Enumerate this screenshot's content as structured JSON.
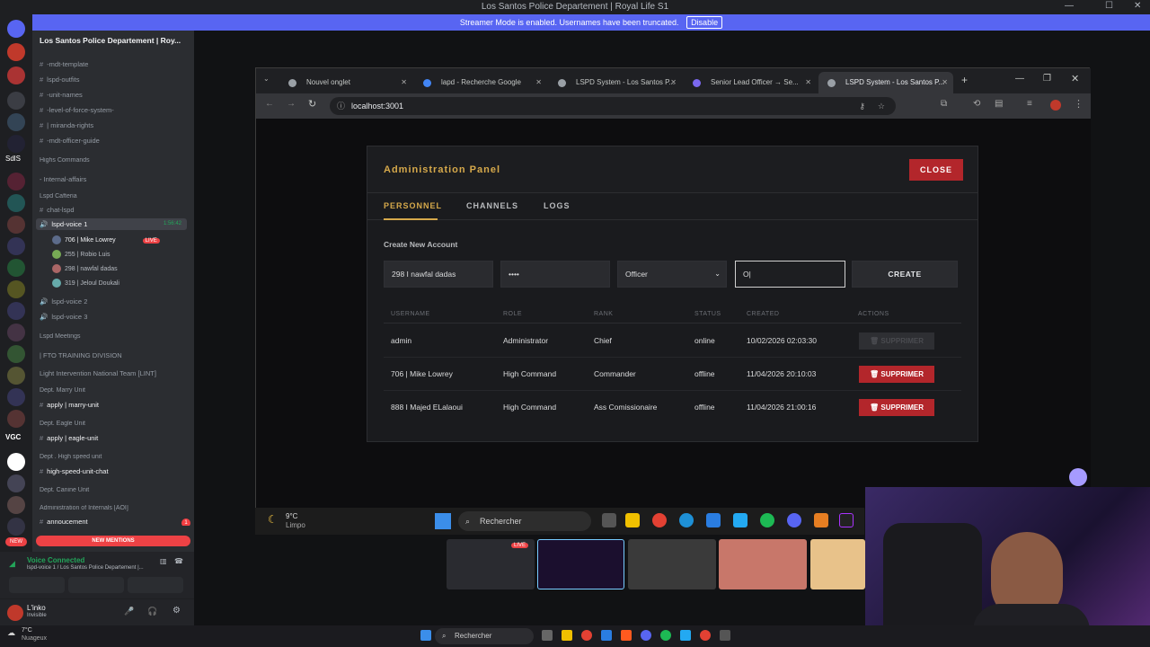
{
  "discord": {
    "window_title": "Los Santos Police Departement | Royal Life S1",
    "streamer_notice": "Streamer Mode is enabled. Usernames have been truncated.",
    "streamer_disable": "Disable",
    "server_name": "Los Santos Police Departement | Roy...",
    "server_initials": "SdlS",
    "channels": [
      "-mdt-template",
      "lspd-outfits",
      "-unit-names",
      "-level-of-force-system-",
      "| miranda-rights",
      "-mdt-officer-guide"
    ],
    "cat_high_commands": "Highs Commands",
    "internal_affairs": "- Internal-affairs",
    "cat_cafeteria": "Lspd Cafteria",
    "chat_lspd": "chat-lspd",
    "voice1": "lspd-voice 1",
    "voice1_timer": "1:56:42",
    "voice_users": [
      "706 | Mike Lowrey",
      "255 | Robio Luis",
      "298 | nawfal dadas",
      "319 | Jeloul Doukali"
    ],
    "live_label": "LIVE",
    "voice2": "lspd-voice 2",
    "voice3": "lspd-voice 3",
    "cat_meetings": "Lspd Meetings",
    "fto": "| FTO TRAINING DIVISION",
    "lint": "Light Intervention National Team [LINT]",
    "cat_marry": "Dept. Marry Unit",
    "apply_marry": "apply | marry-unit",
    "cat_eagle": "Dept. Eagle Unit",
    "apply_eagle": "apply | eagle-unit",
    "cat_highspeed": "Dept . High speed unit",
    "highspeed_chat": "high-speed-unit-chat",
    "cat_canine": "Dept. Canine Unit",
    "cat_admin": "Administration of Internals [AOI]",
    "announcement": "annoucement",
    "announcement_badge": "1",
    "new_mentions": "NEW MENTIONS",
    "voice_connected": "Voice Connected",
    "voice_channel_path": "lspd-voice 1 / Los Santos Police Departement |...",
    "username": "L'inko",
    "user_status": "Invisible",
    "new_badge": "NEW",
    "vgc_label": "VGC"
  },
  "browser": {
    "tabs": [
      {
        "title": "Nouvel onglet"
      },
      {
        "title": "lapd - Recherche Google"
      },
      {
        "title": "LSPD System - Los Santos P..."
      },
      {
        "title": "Senior Lead Officer → Se..."
      },
      {
        "title": "LSPD System - Los Santos P..."
      }
    ],
    "url": "localhost:3001"
  },
  "admin_panel": {
    "title": "Administration Panel",
    "close_label": "CLOSE",
    "tabs": [
      "PERSONNEL",
      "CHANNELS",
      "LOGS"
    ],
    "create_title": "Create New Account",
    "username_value": "298 I nawfal dadas",
    "password_value": "••••",
    "role_selected": "Officer",
    "rank_value": "O|",
    "create_label": "CREATE",
    "columns": [
      "USERNAME",
      "ROLE",
      "RANK",
      "STATUS",
      "CREATED",
      "ACTIONS"
    ],
    "rows": [
      {
        "username": "admin",
        "role": "Administrator",
        "rank": "Chief",
        "status": "online",
        "created": "10/02/2026 02:03:30",
        "action": "SUPPRIMER",
        "action_enabled": false
      },
      {
        "username": "706 | Mike Lowrey",
        "role": "High Command",
        "rank": "Commander",
        "status": "offline",
        "created": "11/04/2026 20:10:03",
        "action": "SUPPRIMER",
        "action_enabled": true
      },
      {
        "username": "888 I Majed ELalaoui",
        "role": "High Command",
        "rank": "Ass Comissionaire",
        "status": "offline",
        "created": "11/04/2026 21:00:16",
        "action": "SUPPRIMER",
        "action_enabled": true
      }
    ]
  },
  "stream_taskbar": {
    "weather_temp": "9°C",
    "weather_desc": "Limpo",
    "search_label": "Rechercher",
    "thumb_live": "LIVE"
  },
  "os_taskbar": {
    "weather_temp": "7°C",
    "weather_desc": "Nuageux",
    "search_label": "Rechercher"
  },
  "colors": {
    "accent_gold": "#d6a94b",
    "danger": "#b3262b",
    "discord_blurple": "#5865f2"
  }
}
